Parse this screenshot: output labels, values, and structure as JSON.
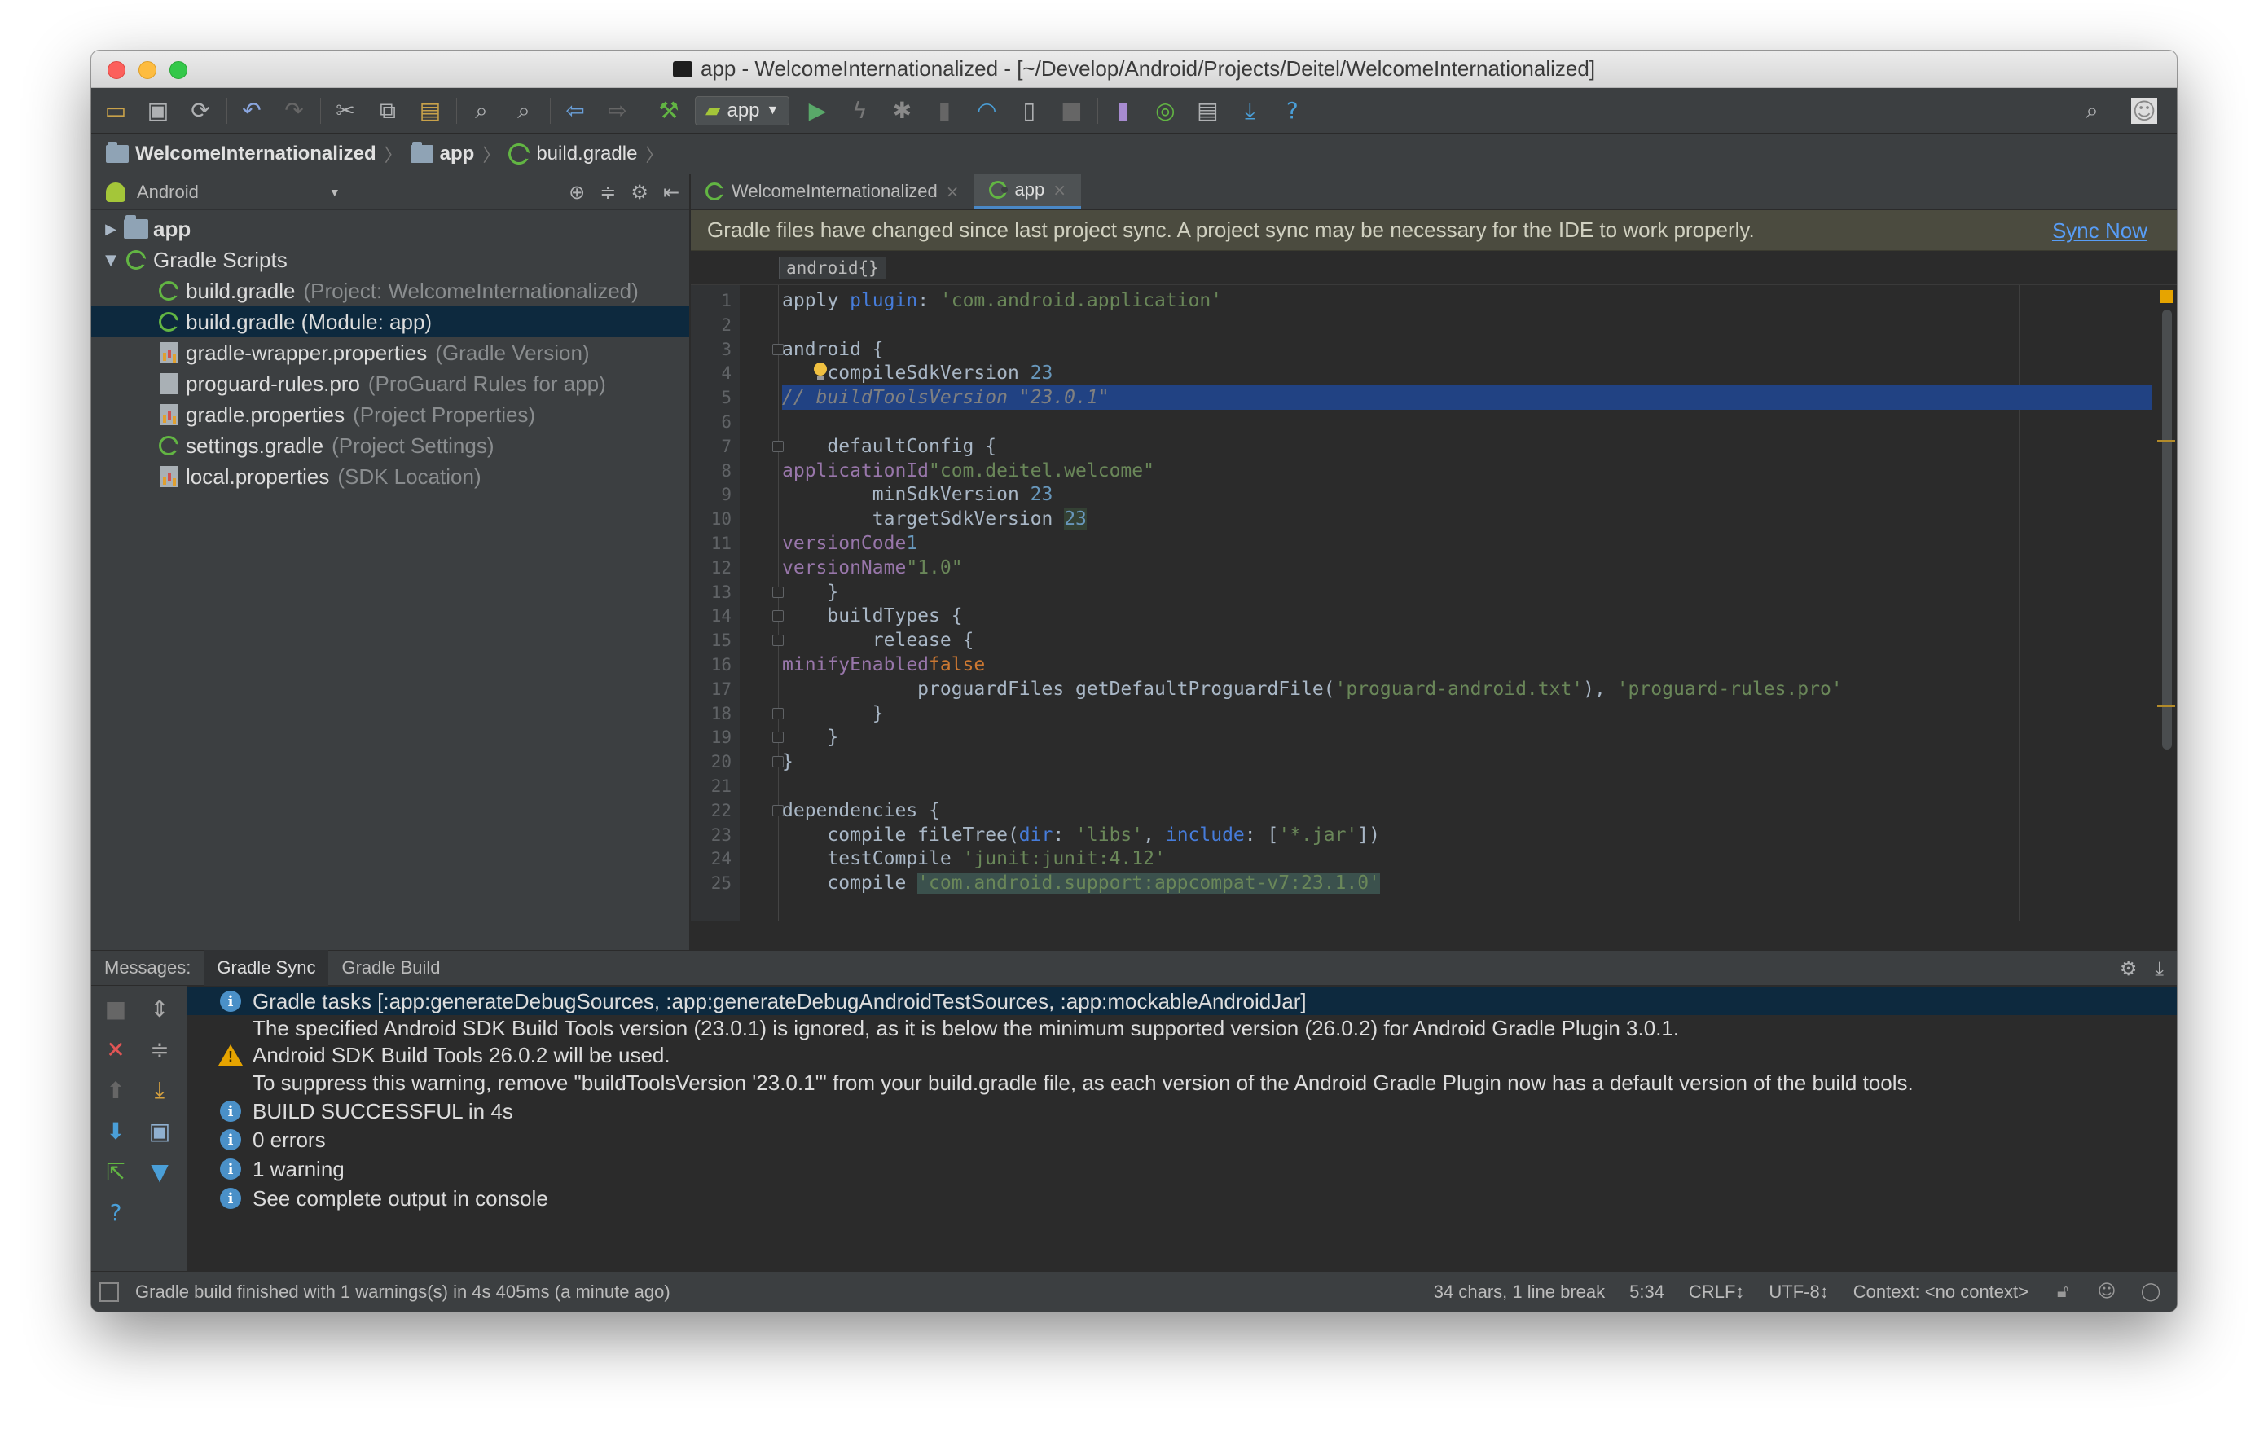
{
  "window": {
    "title": "app - WelcomeInternationalized - [~/Develop/Android/Projects/Deitel/WelcomeInternationalized]"
  },
  "toolbar": {
    "run_config": "app",
    "icons": [
      "open-icon",
      "save-icon",
      "sync-icon",
      "undo-icon",
      "redo-icon",
      "cut-icon",
      "copy-icon",
      "paste-icon",
      "find-icon",
      "replace-icon",
      "back-icon",
      "forward-icon",
      "build-icon",
      "run-icon",
      "apply-changes-icon",
      "debug-icon",
      "profile-icon",
      "attach-debugger-icon",
      "stop-icon",
      "avd-manager-icon",
      "sync-gradle-icon",
      "project-structure-icon",
      "sdk-manager-icon",
      "help-icon"
    ]
  },
  "breadcrumb": {
    "items": [
      "WelcomeInternationalized",
      "app",
      "build.gradle"
    ]
  },
  "project_panel": {
    "view_label": "Android",
    "tree": [
      {
        "label": "app",
        "hint": "",
        "indent": 0,
        "arrow": "▶",
        "icon": "folder",
        "selected": false
      },
      {
        "label": "Gradle Scripts",
        "hint": "",
        "indent": 0,
        "arrow": "▼",
        "icon": "gradle",
        "selected": false
      },
      {
        "label": "build.gradle",
        "hint": "(Project: WelcomeInternationalized)",
        "indent": 1,
        "arrow": "",
        "icon": "gradle",
        "selected": false
      },
      {
        "label": "build.gradle (Module: app)",
        "hint": "",
        "indent": 1,
        "arrow": "",
        "icon": "gradle",
        "selected": true
      },
      {
        "label": "gradle-wrapper.properties",
        "hint": "(Gradle Version)",
        "indent": 1,
        "arrow": "",
        "icon": "props",
        "selected": false
      },
      {
        "label": "proguard-rules.pro",
        "hint": "(ProGuard Rules for app)",
        "indent": 1,
        "arrow": "",
        "icon": "pro",
        "selected": false
      },
      {
        "label": "gradle.properties",
        "hint": "(Project Properties)",
        "indent": 1,
        "arrow": "",
        "icon": "props",
        "selected": false
      },
      {
        "label": "settings.gradle",
        "hint": "(Project Settings)",
        "indent": 1,
        "arrow": "",
        "icon": "gradle",
        "selected": false
      },
      {
        "label": "local.properties",
        "hint": "(SDK Location)",
        "indent": 1,
        "arrow": "",
        "icon": "props",
        "selected": false
      }
    ]
  },
  "editor": {
    "tabs": [
      {
        "label": "WelcomeInternationalized",
        "active": false
      },
      {
        "label": "app",
        "active": true
      }
    ],
    "sync_banner": {
      "message": "Gradle files have changed since last project sync. A project sync may be necessary for the IDE to work properly.",
      "link": "Sync Now"
    },
    "code_breadcrumb": "android{}",
    "lines": [
      {
        "n": "1",
        "html": "apply <span class=\"named\">plugin</span>: <span class=\"str\">'com.android.application'</span>"
      },
      {
        "n": "2",
        "html": ""
      },
      {
        "n": "3",
        "html": "android {"
      },
      {
        "n": "4",
        "html": "    compileSdkVersion <span class=\"num\">23</span>"
      },
      {
        "n": "5",
        "html": "    <span class=\"cmt\">// buildToolsVersion \"23.0.1\"</span>"
      },
      {
        "n": "6",
        "html": ""
      },
      {
        "n": "7",
        "html": "    defaultConfig {"
      },
      {
        "n": "8",
        "html": "        <span class=\"prop\">applicationId</span> <span class=\"str\">\"com.deitel.welcome\"</span>"
      },
      {
        "n": "9",
        "html": "        minSdkVersion <span class=\"num\">23</span>"
      },
      {
        "n": "10",
        "html": "        targetSdkVersion <span class=\"num hl2\">23</span>"
      },
      {
        "n": "11",
        "html": "        <span class=\"prop\">versionCode</span> <span class=\"num\">1</span>"
      },
      {
        "n": "12",
        "html": "        <span class=\"prop\">versionName</span> <span class=\"str\">\"1.0\"</span>"
      },
      {
        "n": "13",
        "html": "    }"
      },
      {
        "n": "14",
        "html": "    buildTypes {"
      },
      {
        "n": "15",
        "html": "        release {"
      },
      {
        "n": "16",
        "html": "            <span class=\"prop\">minifyEnabled</span> <span class=\"kw\">false</span>"
      },
      {
        "n": "17",
        "html": "            proguardFiles getDefaultProguardFile(<span class=\"str\">'proguard-android.txt'</span>), <span class=\"str\">'proguard-rules.pro'</span>"
      },
      {
        "n": "18",
        "html": "        }"
      },
      {
        "n": "19",
        "html": "    }"
      },
      {
        "n": "20",
        "html": "}"
      },
      {
        "n": "21",
        "html": ""
      },
      {
        "n": "22",
        "html": "dependencies {"
      },
      {
        "n": "23",
        "html": "    compile fileTree(<span class=\"named\">dir</span>: <span class=\"str\">'libs'</span>, <span class=\"named\">include</span>: [<span class=\"str\">'*.jar'</span>])"
      },
      {
        "n": "24",
        "html": "    testCompile <span class=\"str\">'junit:junit:4.12'</span>"
      },
      {
        "n": "25",
        "html": "    compile <span class=\"str hlbox\">'com.android.support:appcompat-v7:23.1.0'</span>"
      }
    ]
  },
  "messages": {
    "label": "Messages:",
    "tabs": [
      "Gradle Sync",
      "Gradle Build"
    ],
    "rows": [
      {
        "icon": "info",
        "text": "Gradle tasks [:app:generateDebugSources, :app:generateDebugAndroidTestSources, :app:mockableAndroidJar]"
      },
      {
        "icon": "none",
        "text": "The specified Android SDK Build Tools version (23.0.1) is ignored, as it is below the minimum supported version (26.0.2) for Android Gradle Plugin 3.0.1."
      },
      {
        "icon": "warning",
        "text": "Android SDK Build Tools 26.0.2 will be used."
      },
      {
        "icon": "none",
        "text": "To suppress this warning, remove \"buildToolsVersion '23.0.1'\" from your build.gradle file, as each version of the Android Gradle Plugin now has a default version of the build tools."
      },
      {
        "icon": "info",
        "text": "BUILD SUCCESSFUL in 4s"
      },
      {
        "icon": "info",
        "text": "0 errors"
      },
      {
        "icon": "info",
        "text": "1 warning"
      },
      {
        "icon": "info",
        "text": "See complete output in console"
      }
    ]
  },
  "status_bar": {
    "message": "Gradle build finished with 1 warnings(s) in 4s 405ms (a minute ago)",
    "selection": "34 chars, 1 line break",
    "position": "5:34",
    "line_separator": "CRLF↕",
    "encoding": "UTF-8↕",
    "context": "Context: <no context>"
  }
}
